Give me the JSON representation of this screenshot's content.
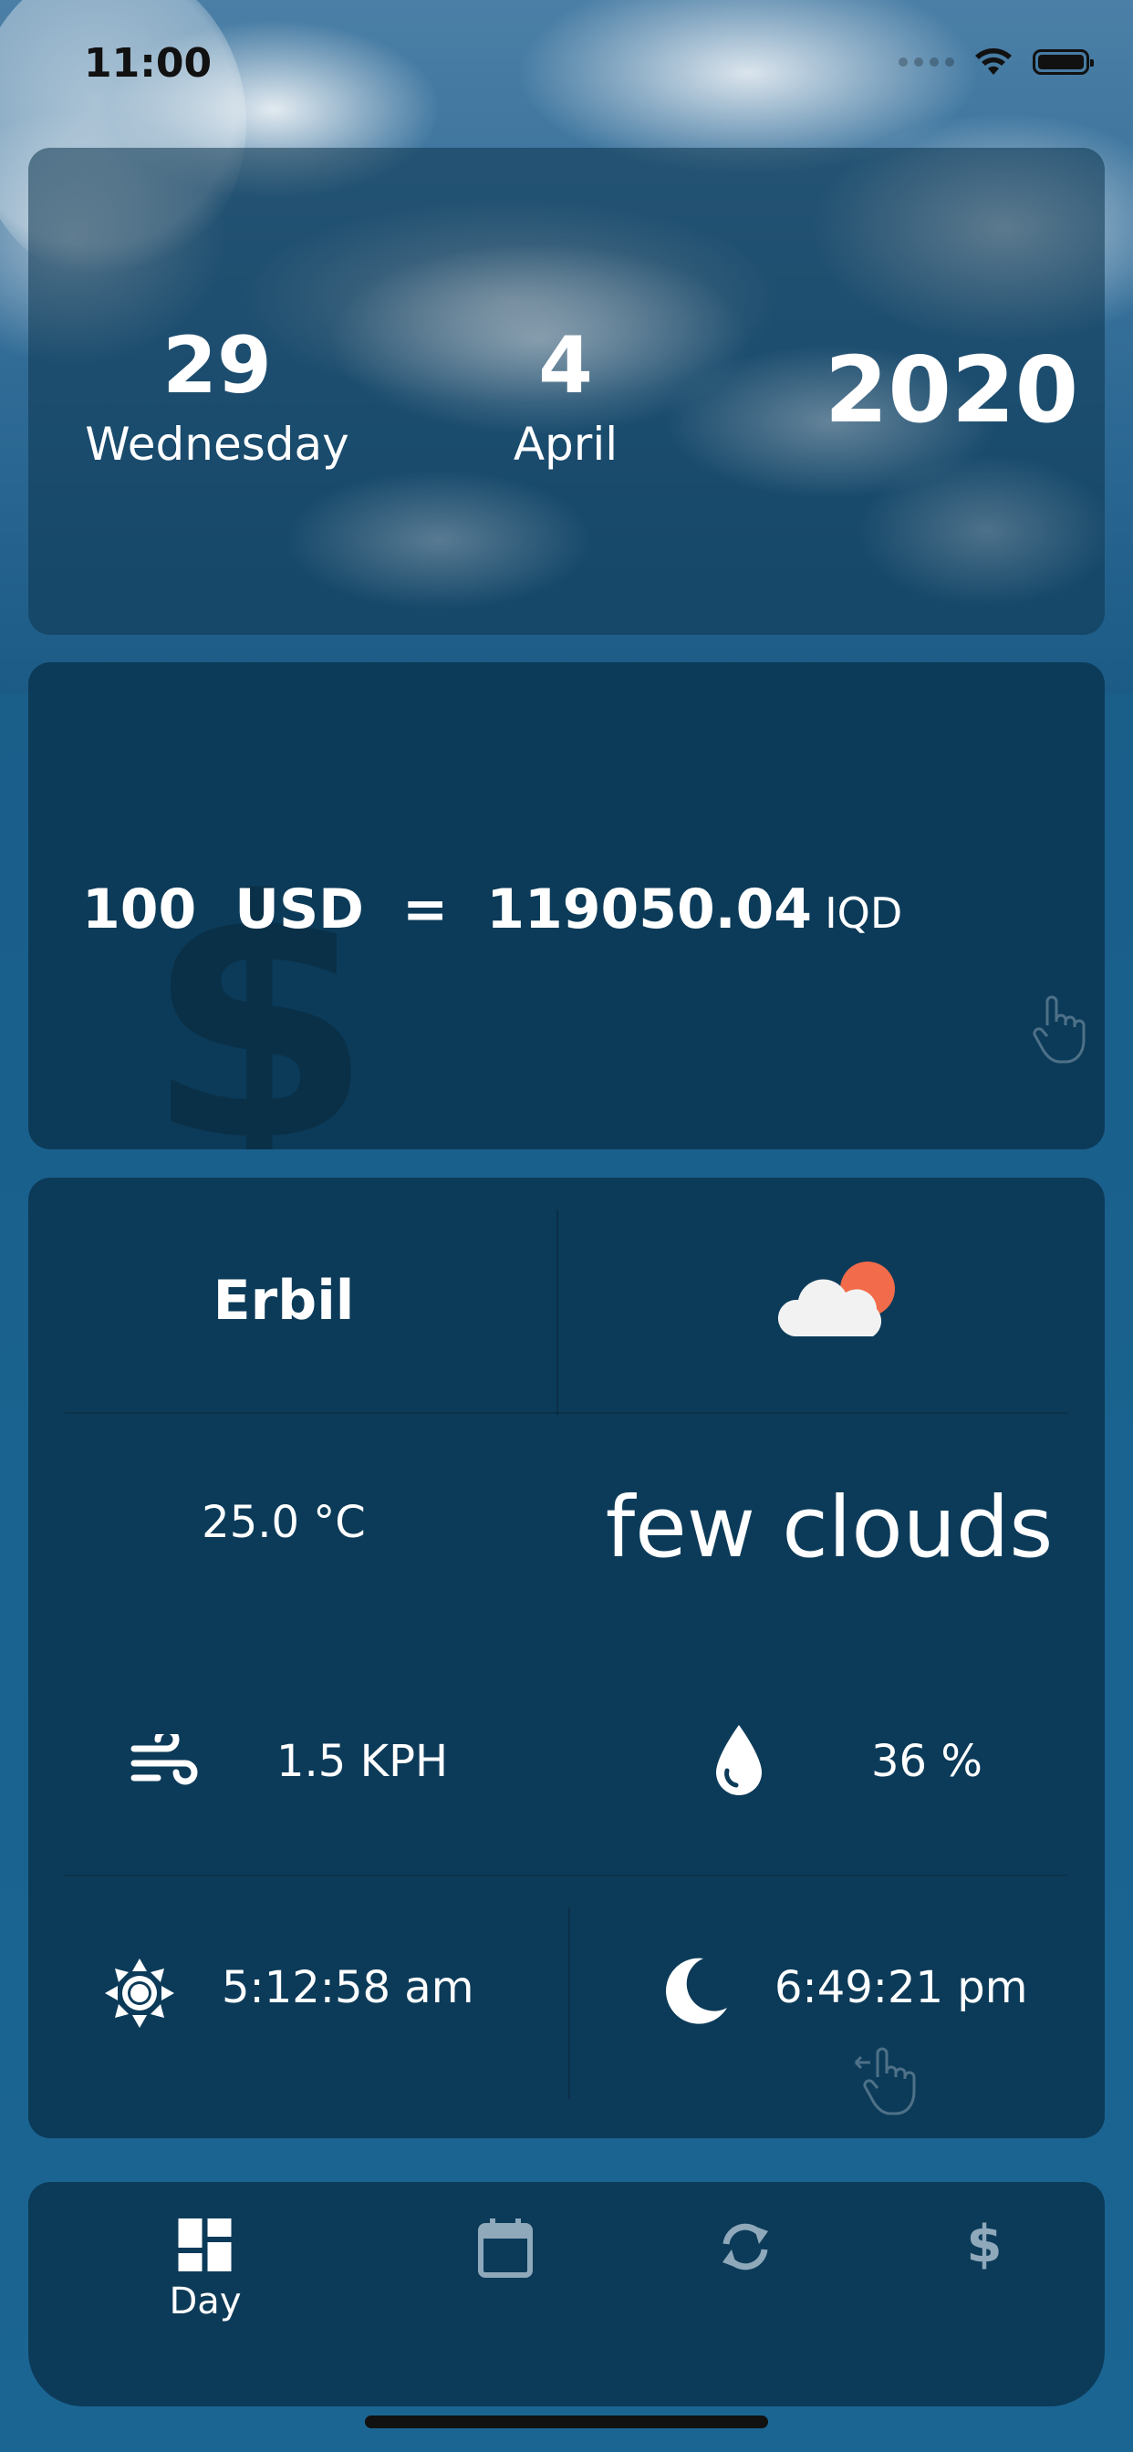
{
  "status": {
    "time": "11:00"
  },
  "date": {
    "day": "29",
    "weekday": "Wednesday",
    "month_num": "4",
    "month_name": "April",
    "year": "2020"
  },
  "currency": {
    "amount": "100",
    "from": "USD",
    "equals": "=",
    "result": "119050.04",
    "to": "IQD"
  },
  "weather": {
    "city": "Erbil",
    "condition_icon": "partly-cloudy-icon",
    "temperature": "25.0 °C",
    "description": "few clouds",
    "wind": "1.5 KPH",
    "humidity": "36 %",
    "sunrise": "5:12:58 am",
    "sunset": "6:49:21 pm"
  },
  "nav": {
    "items": [
      {
        "icon": "dashboard-icon",
        "label": "Day",
        "active": true
      },
      {
        "icon": "calendar-icon",
        "label": ""
      },
      {
        "icon": "sync-icon",
        "label": ""
      },
      {
        "icon": "dollar-icon",
        "label": ""
      }
    ]
  },
  "colors": {
    "background": "#1a5d89",
    "card": "#0c3b59",
    "text": "#ffffff",
    "sun_orange": "#f26b4a"
  }
}
